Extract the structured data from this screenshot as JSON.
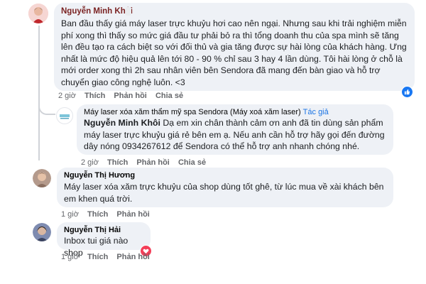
{
  "comments": [
    {
      "author": "Nguyễn Minh Khôi",
      "text": "Ban đầu thấy giá máy laser trực khuỷu hơi cao nên ngại. Nhưng sau khi trải nghiệm miễn phí xong thì thấy so mức giá đầu tư phải bỏ ra thì tổng doanh thu của spa mình sẽ tăng lên đều tạo ra cách biệt so với đối thủ và gia tăng được sự hài lòng của khách hàng. Ưng nhất là mức độ hiệu quả lên tới 80 - 90 % chỉ sau 3 hay 4 lần dùng. Tôi hài lòng ở chỗ là mới order xong thì 2h sau nhân viên bên Sendora đã mang đến bàn giao và hỗ trợ chuyển giao công nghệ luôn. <3",
      "time": "2 giờ",
      "like": "Thích",
      "reply": "Phản hồi",
      "share": "Chia sẻ"
    },
    {
      "author": "Máy laser xóa xăm thẩm mỹ spa Sendora (Máy xoá xăm laser)",
      "tag": "Tác giả",
      "mention": "Nguyễn Minh Khôi",
      "text": " Dạ em xin chân thành cảm ơn anh đã tin dùng sản phẩm máy laser trực khuỷu giá rẻ bên em ạ. Nếu anh cần hỗ trợ hãy gọi đến đường dây nóng 0934267612 để Sendora có thể hỗ trợ anh nhanh chóng nhé.",
      "time": "2 giờ",
      "like": "Thích",
      "reply": "Phản hồi",
      "share": "Chia sẻ"
    },
    {
      "author": "Nguyễn Thị Hương",
      "text": "Máy laser xóa xăm trực khuỷu của shop dùng tốt ghê, từ lúc mua về xài khách bên em khen quá trời.",
      "time": "1 giờ",
      "like": "Thích",
      "reply": "Phản hồi"
    },
    {
      "author": "Nguyễn Thị Hải",
      "text": "Inbox tui giá nào shop",
      "time": "1 giờ",
      "like": "Thích",
      "reply": "Phản hồi"
    }
  ],
  "colors": {
    "bubble": "#eef1f6",
    "like_blue": "#1877f2",
    "love_red": "#f33e58"
  },
  "icons": [
    "like-reaction-icon",
    "love-reaction-icon",
    "more-options-icon"
  ]
}
